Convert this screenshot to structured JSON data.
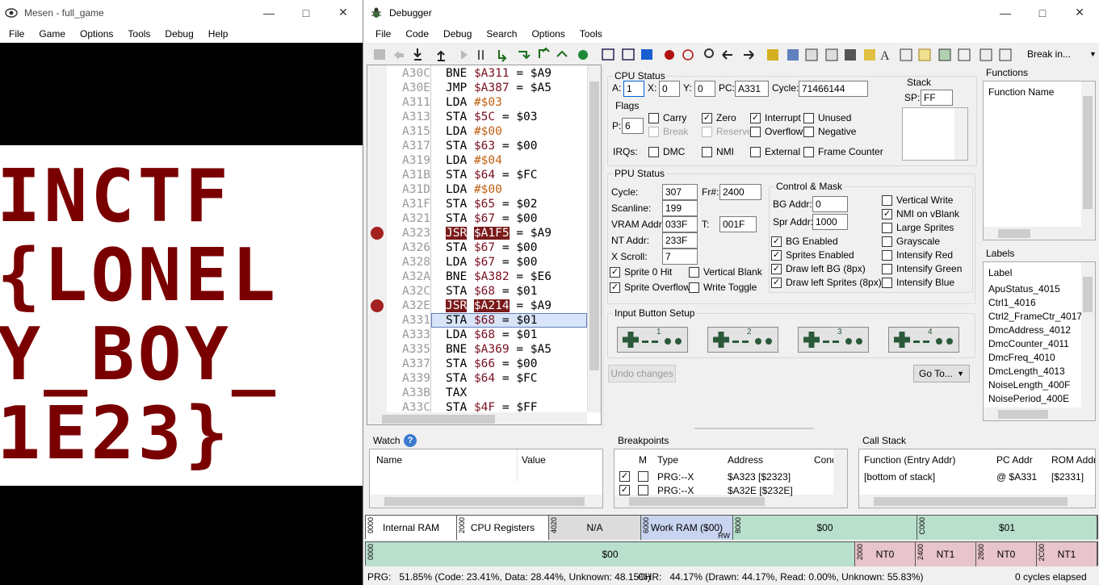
{
  "mesen": {
    "title": "Mesen - full_game",
    "menu": [
      "File",
      "Game",
      "Options",
      "Tools",
      "Debug",
      "Help"
    ],
    "game_text": [
      "INCTF",
      "{LONEL",
      "Y_BOY_",
      "1E23}"
    ]
  },
  "debugger": {
    "title": "Debugger",
    "menu": [
      "File",
      "Code",
      "Debug",
      "Search",
      "Options",
      "Tools"
    ],
    "break_in": "Break in...",
    "code": [
      {
        "addr": "A30C",
        "op": "BNE",
        "arg": "$A311",
        "rest": " = $A9",
        "bp": false,
        "hl": false
      },
      {
        "addr": "A30E",
        "op": "JMP",
        "arg": "$A387",
        "rest": " = $A5",
        "bp": false,
        "hl": false
      },
      {
        "addr": "A311",
        "op": "LDA",
        "arg": "#$03",
        "rest": "",
        "bp": false,
        "hl": false
      },
      {
        "addr": "A313",
        "op": "STA",
        "arg": "$5C",
        "rest": " = $03",
        "bp": false,
        "hl": false
      },
      {
        "addr": "A315",
        "op": "LDA",
        "arg": "#$00",
        "rest": "",
        "bp": false,
        "hl": false
      },
      {
        "addr": "A317",
        "op": "STA",
        "arg": "$63",
        "rest": " = $00",
        "bp": false,
        "hl": false
      },
      {
        "addr": "A319",
        "op": "LDA",
        "arg": "#$04",
        "rest": "",
        "bp": false,
        "hl": false
      },
      {
        "addr": "A31B",
        "op": "STA",
        "arg": "$64",
        "rest": " = $FC",
        "bp": false,
        "hl": false
      },
      {
        "addr": "A31D",
        "op": "LDA",
        "arg": "#$00",
        "rest": "",
        "bp": false,
        "hl": false
      },
      {
        "addr": "A31F",
        "op": "STA",
        "arg": "$65",
        "rest": " = $02",
        "bp": false,
        "hl": false
      },
      {
        "addr": "A321",
        "op": "STA",
        "arg": "$67",
        "rest": " = $00",
        "bp": false,
        "hl": false
      },
      {
        "addr": "A323",
        "op": "JSR",
        "arg": "$A1F5",
        "rest": " = $A9",
        "bp": true,
        "hl": false
      },
      {
        "addr": "A326",
        "op": "STA",
        "arg": "$67",
        "rest": " = $00",
        "bp": false,
        "hl": false
      },
      {
        "addr": "A328",
        "op": "LDA",
        "arg": "$67",
        "rest": " = $00",
        "bp": false,
        "hl": false
      },
      {
        "addr": "A32A",
        "op": "BNE",
        "arg": "$A382",
        "rest": " = $E6",
        "bp": false,
        "hl": false
      },
      {
        "addr": "A32C",
        "op": "STA",
        "arg": "$68",
        "rest": " = $01",
        "bp": false,
        "hl": false
      },
      {
        "addr": "A32E",
        "op": "JSR",
        "arg": "$A214",
        "rest": " = $A9",
        "bp": true,
        "hl": false
      },
      {
        "addr": "A331",
        "op": "STA",
        "arg": "$68",
        "rest": " = $01",
        "bp": false,
        "hl": true
      },
      {
        "addr": "A333",
        "op": "LDA",
        "arg": "$68",
        "rest": " = $01",
        "bp": false,
        "hl": false
      },
      {
        "addr": "A335",
        "op": "BNE",
        "arg": "$A369",
        "rest": " = $A5",
        "bp": false,
        "hl": false
      },
      {
        "addr": "A337",
        "op": "STA",
        "arg": "$66",
        "rest": " = $00",
        "bp": false,
        "hl": false
      },
      {
        "addr": "A339",
        "op": "STA",
        "arg": "$64",
        "rest": " = $FC",
        "bp": false,
        "hl": false
      },
      {
        "addr": "A33B",
        "op": "TAX",
        "arg": "",
        "rest": "",
        "bp": false,
        "hl": false
      },
      {
        "addr": "A33C",
        "op": "STA",
        "arg": "$4F",
        "rest": " = $FF",
        "bp": false,
        "hl": false
      }
    ],
    "cpu": {
      "label": "CPU Status",
      "a_label": "A:",
      "a": "1",
      "x_label": "X:",
      "x": "0",
      "y_label": "Y:",
      "y": "0",
      "pc_label": "PC:",
      "pc": "A331",
      "cycle_label": "Cycle:",
      "cycle": "71466144",
      "stack_label": "Stack",
      "sp_label": "SP:",
      "sp": "FF",
      "flags_label": "Flags",
      "p_label": "P:",
      "p": "6",
      "irqs_label": "IRQs:"
    },
    "flags": [
      {
        "label": "Carry",
        "checked": false,
        "disabled": false
      },
      {
        "label": "Zero",
        "checked": true,
        "disabled": false
      },
      {
        "label": "Interrupt",
        "checked": true,
        "disabled": false
      },
      {
        "label": "Unused",
        "checked": false,
        "disabled": false
      },
      {
        "label": "Break",
        "checked": false,
        "disabled": true
      },
      {
        "label": "Reserved",
        "checked": false,
        "disabled": true
      },
      {
        "label": "Overflow",
        "checked": false,
        "disabled": false
      },
      {
        "label": "Negative",
        "checked": false,
        "disabled": false
      }
    ],
    "irqs": [
      {
        "label": "DMC",
        "checked": false
      },
      {
        "label": "NMI",
        "checked": false
      },
      {
        "label": "External",
        "checked": false
      },
      {
        "label": "Frame Counter",
        "checked": false
      }
    ],
    "ppu": {
      "label": "PPU Status",
      "cycle_label": "Cycle:",
      "cycle": "307",
      "fr_label": "Fr#:",
      "fr": "2400",
      "scanline_label": "Scanline:",
      "scanline": "199",
      "vram_label": "VRAM Addr:",
      "vram": "033F",
      "t_label": "T:",
      "t": "001F",
      "nt_label": "NT Addr:",
      "nt": "233F",
      "xscroll_label": "X Scroll:",
      "xscroll": "7",
      "cm_label": "Control & Mask",
      "bg_addr_label": "BG Addr:",
      "bg_addr": "0",
      "spr_addr_label": "Spr Addr:",
      "spr_addr": "1000"
    },
    "ppu_status_flags": [
      {
        "label": "Sprite 0 Hit",
        "checked": true
      },
      {
        "label": "Vertical Blank",
        "checked": false
      },
      {
        "label": "Sprite Overflow",
        "checked": true
      },
      {
        "label": "Write Toggle",
        "checked": false
      }
    ],
    "ppu_mask_left": [
      {
        "label": "BG Enabled",
        "checked": true
      },
      {
        "label": "Sprites Enabled",
        "checked": true
      },
      {
        "label": "Draw left BG (8px)",
        "checked": true
      },
      {
        "label": "Draw left Sprites (8px)",
        "checked": true
      }
    ],
    "ppu_mask_right": [
      {
        "label": "Vertical Write",
        "checked": false
      },
      {
        "label": "NMI on vBlank",
        "checked": true
      },
      {
        "label": "Large Sprites",
        "checked": false
      },
      {
        "label": "Grayscale",
        "checked": false
      },
      {
        "label": "Intensify Red",
        "checked": false
      },
      {
        "label": "Intensify Green",
        "checked": false
      },
      {
        "label": "Intensify Blue",
        "checked": false
      }
    ],
    "input_label": "Input Button Setup",
    "controllers": [
      "1",
      "2",
      "3",
      "4"
    ],
    "undo_label": "Undo changes",
    "goto_label": "Go To...",
    "functions": {
      "label": "Functions",
      "header": "Function Name"
    },
    "labels": {
      "label": "Labels",
      "header": "Label",
      "items": [
        "ApuStatus_4015",
        "Ctrl1_4016",
        "Ctrl2_FrameCtr_4017",
        "DmcAddress_4012",
        "DmcCounter_4011",
        "DmcFreq_4010",
        "DmcLength_4013",
        "NoiseLength_400F",
        "NoisePeriod_400E"
      ]
    },
    "watch": {
      "label": "Watch",
      "name_col": "Name",
      "value_col": "Value"
    },
    "breakpoints": {
      "label": "Breakpoints",
      "cols": [
        "M",
        "Type",
        "Address",
        "Cond"
      ],
      "rows": [
        {
          "type": "PRG:--X",
          "address": "$A323 [$2323]",
          "enabled": true
        },
        {
          "type": "PRG:--X",
          "address": "$A32E [$232E]",
          "enabled": true
        }
      ]
    },
    "callstack": {
      "label": "Call Stack",
      "cols": [
        "Function (Entry Addr)",
        "PC Addr",
        "ROM Addr"
      ],
      "rows": [
        {
          "fn": "[bottom of stack]",
          "pc": "@ $A331",
          "rom": "[$2331]"
        }
      ]
    },
    "cpu_mem": [
      {
        "tag": "0000",
        "label": "Internal RAM"
      },
      {
        "tag": "2000",
        "label": "CPU Registers"
      },
      {
        "tag": "4020",
        "label": "N/A"
      },
      {
        "tag": "6000",
        "label": "Work RAM ($00)",
        "sub": "RW"
      },
      {
        "tag": "8000",
        "label": "$00"
      },
      {
        "tag": "C000",
        "label": "$01"
      }
    ],
    "ppu_mem": [
      {
        "tag": "0000",
        "label": "$00"
      },
      {
        "tag": "2000",
        "label": "NT0"
      },
      {
        "tag": "2400",
        "label": "NT1"
      },
      {
        "tag": "2800",
        "label": "NT0"
      },
      {
        "tag": "2C00",
        "label": "NT1"
      }
    ],
    "status": {
      "prg": "PRG:   51.85% (Code: 23.41%, Data: 28.44%, Unknown: 48.15%)",
      "chr": "CHR:   44.17% (Drawn: 44.17%, Read: 0.00%, Unknown: 55.83%)",
      "cycles": "0 cycles elapsed"
    },
    "colors": {
      "accent": "#800000",
      "mem_green": "#b8e0cc",
      "mem_pink": "#e8c4cc",
      "mem_blue": "#c8d4f0",
      "window_bg": "#f0f0f0"
    }
  }
}
